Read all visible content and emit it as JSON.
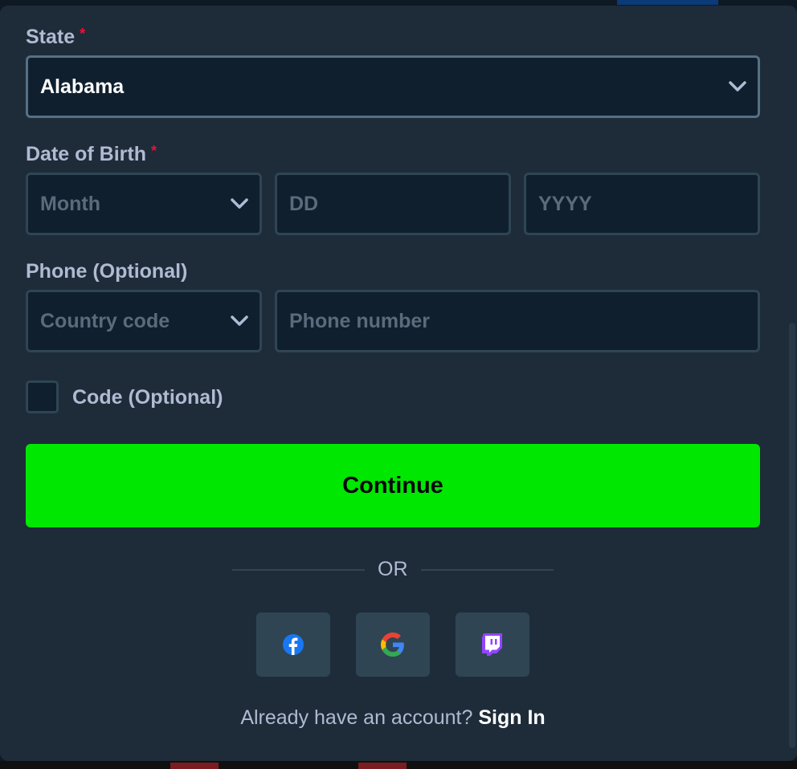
{
  "form": {
    "state": {
      "label": "State",
      "required_mark": "*",
      "value": "Alabama"
    },
    "dob": {
      "label": "Date of Birth",
      "required_mark": "*",
      "month_placeholder": "Month",
      "day_placeholder": "DD",
      "year_placeholder": "YYYY"
    },
    "phone": {
      "label": "Phone (Optional)",
      "country_placeholder": "Country code",
      "number_placeholder": "Phone number"
    },
    "code": {
      "label": "Code (Optional)",
      "checked": false
    },
    "continue_label": "Continue",
    "or_label": "OR",
    "social": [
      "facebook-icon",
      "google-icon",
      "twitch-icon"
    ],
    "footer": {
      "text": "Already have an account?",
      "link": "Sign In"
    }
  },
  "colors": {
    "accent": "#00e701",
    "required": "#e9113c",
    "panel": "#1e2c39",
    "input_bg": "#0f1f2e"
  }
}
